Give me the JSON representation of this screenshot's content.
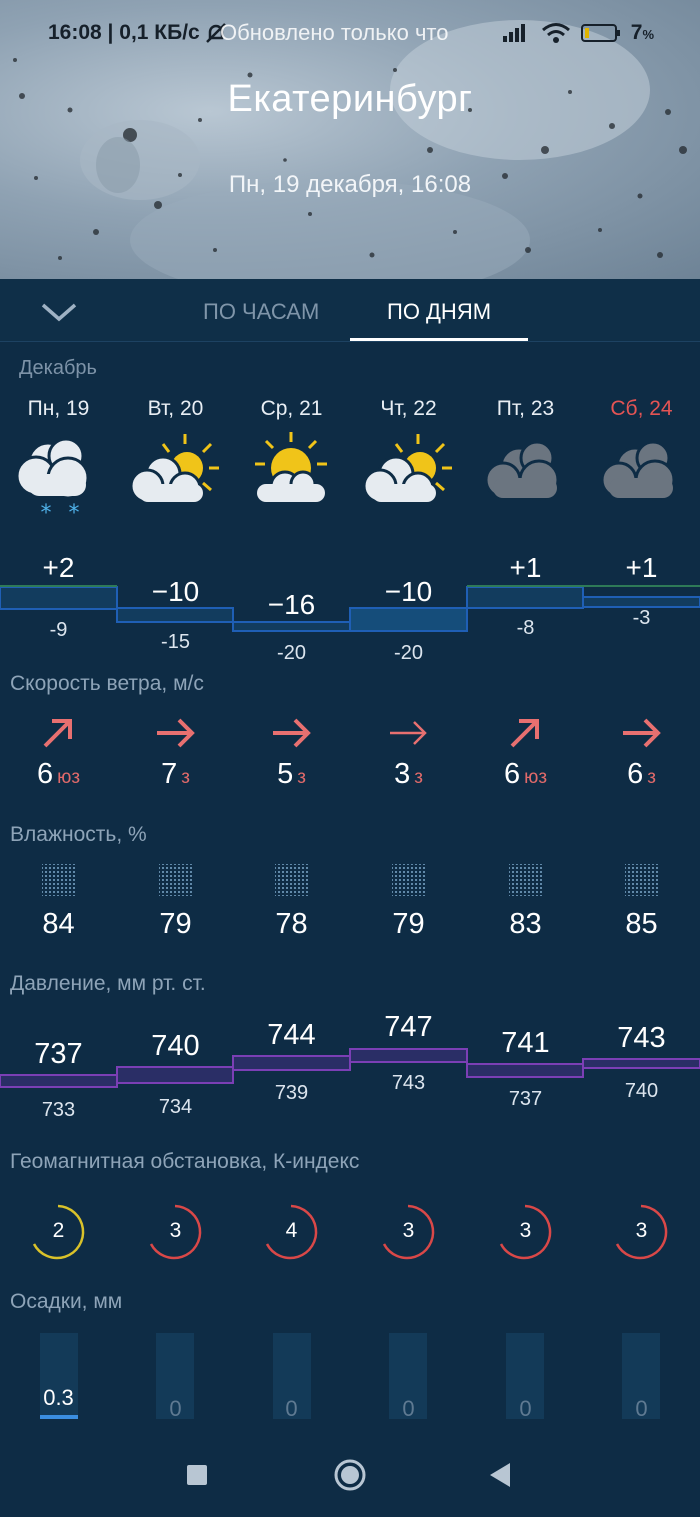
{
  "status_bar": {
    "time": "16:08",
    "speed": "0,1 КБ/с",
    "updated": "Обновлено только что",
    "battery": "7"
  },
  "header": {
    "city": "Екатеринбург",
    "datetime": "Пн, 19 декабря, 16:08"
  },
  "tabs": [
    {
      "label": "ПО ЧАСАМ",
      "active": false
    },
    {
      "label": "ПО ДНЯМ",
      "active": true
    }
  ],
  "month": "Декабрь",
  "days": [
    {
      "label": "Пн, 19",
      "weekend": false,
      "icon": "cloud-snow-icon",
      "t_max": "+2",
      "t_min": "-9",
      "wind_speed": "6",
      "wind_dir": "юз",
      "humidity": "84",
      "p_max": "737",
      "p_min": "733",
      "k_index": "2",
      "precip": "0.3"
    },
    {
      "label": "Вт, 20",
      "weekend": false,
      "icon": "partly-cloudy-icon",
      "t_max": "−10",
      "t_min": "-15",
      "wind_speed": "7",
      "wind_dir": "з",
      "humidity": "79",
      "p_max": "740",
      "p_min": "734",
      "k_index": "3",
      "precip": "0"
    },
    {
      "label": "Ср, 21",
      "weekend": false,
      "icon": "sun-cloud-icon",
      "t_max": "−16",
      "t_min": "-20",
      "wind_speed": "5",
      "wind_dir": "з",
      "humidity": "78",
      "p_max": "744",
      "p_min": "739",
      "k_index": "4",
      "precip": "0"
    },
    {
      "label": "Чт, 22",
      "weekend": false,
      "icon": "partly-cloudy-icon",
      "t_max": "−10",
      "t_min": "-20",
      "wind_speed": "3",
      "wind_dir": "з",
      "humidity": "79",
      "p_max": "747",
      "p_min": "743",
      "k_index": "3",
      "precip": "0"
    },
    {
      "label": "Пт, 23",
      "weekend": false,
      "icon": "overcast-icon",
      "t_max": "+1",
      "t_min": "-8",
      "wind_speed": "6",
      "wind_dir": "юз",
      "humidity": "83",
      "p_max": "741",
      "p_min": "737",
      "k_index": "3",
      "precip": "0"
    },
    {
      "label": "Сб, 24",
      "weekend": true,
      "icon": "overcast-icon",
      "t_max": "+1",
      "t_min": "-3",
      "wind_speed": "6",
      "wind_dir": "з",
      "humidity": "85",
      "p_max": "743",
      "p_min": "740",
      "k_index": "3",
      "precip": "0"
    }
  ],
  "sections": {
    "wind": "Скорость ветра, м/с",
    "humidity": "Влажность, %",
    "pressure": "Давление, мм рт. ст.",
    "geomagnetic": "Геомагнитная обстановка, К-индекс",
    "precipitation": "Осадки, мм"
  },
  "colors": {
    "background": "#0e2c45",
    "temp_band": "#1f5fb5",
    "pressure_band": "#7b3fb5",
    "wind_arrow": "#e87070",
    "weekend": "#e45454",
    "k_low": "#d9c22a",
    "k_high": "#d94848"
  }
}
